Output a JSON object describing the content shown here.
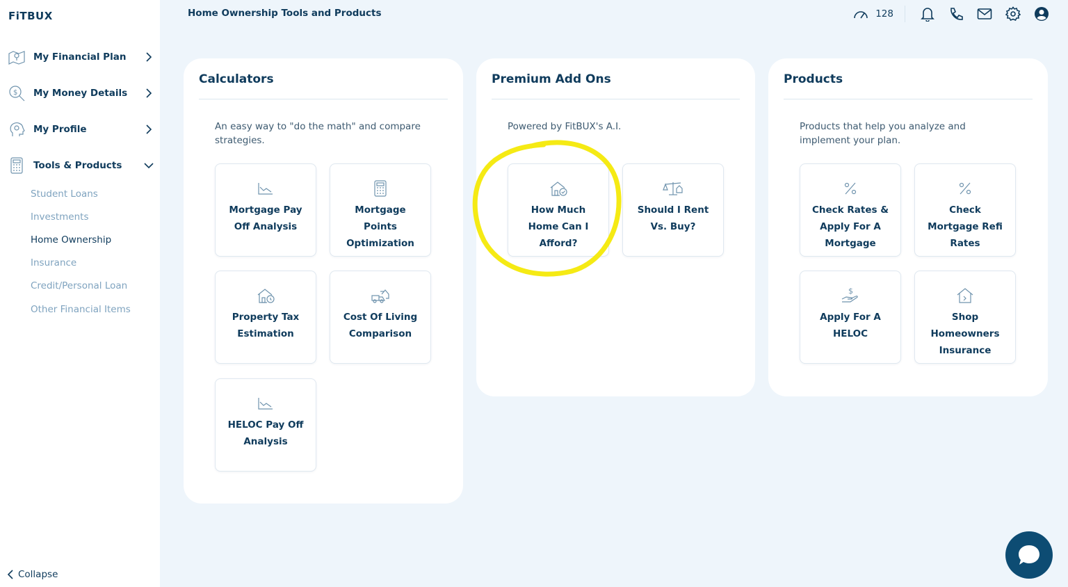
{
  "sidebar": {
    "logo": "FiTBUX",
    "nav": [
      {
        "label": "My Financial Plan"
      },
      {
        "label": "My Money Details"
      },
      {
        "label": "My Profile"
      },
      {
        "label": "Tools & Products"
      }
    ],
    "sub_items": [
      {
        "label": "Student Loans"
      },
      {
        "label": "Investments"
      },
      {
        "label": "Home Ownership"
      },
      {
        "label": "Insurance"
      },
      {
        "label": "Credit/Personal Loan"
      },
      {
        "label": "Other Financial Items"
      }
    ],
    "collapse_label": "Collapse"
  },
  "header": {
    "title": "Home Ownership Tools and Products",
    "score": "128"
  },
  "panels": {
    "calculators": {
      "title": "Calculators",
      "description": "An easy way to \"do the math\" and compare strategies.",
      "cards": [
        {
          "label": "Mortgage Pay Off Analysis"
        },
        {
          "label": "Mortgage Points Optimization"
        },
        {
          "label": "Property Tax Estimation"
        },
        {
          "label": "Cost Of Living Comparison"
        },
        {
          "label": "HELOC Pay Off Analysis"
        }
      ]
    },
    "premium": {
      "title": "Premium Add Ons",
      "description": "Powered by FitBUX's A.I.",
      "cards": [
        {
          "label": "How Much Home Can I Afford?"
        },
        {
          "label": "Should I Rent Vs. Buy?"
        }
      ]
    },
    "products": {
      "title": "Products",
      "description": "Products that help you analyze and implement your plan.",
      "cards": [
        {
          "label": "Check Rates & Apply For A Mortgage"
        },
        {
          "label": "Check Mortgage Refi Rates"
        },
        {
          "label": "Apply For A HELOC"
        },
        {
          "label": "Shop Homeowners Insurance"
        }
      ]
    }
  },
  "colors": {
    "primary": "#0f3b5c",
    "muted": "#7fa3bf",
    "background": "#eef5fb",
    "annotation": "#f5ea14",
    "chat": "#0d4c73"
  }
}
